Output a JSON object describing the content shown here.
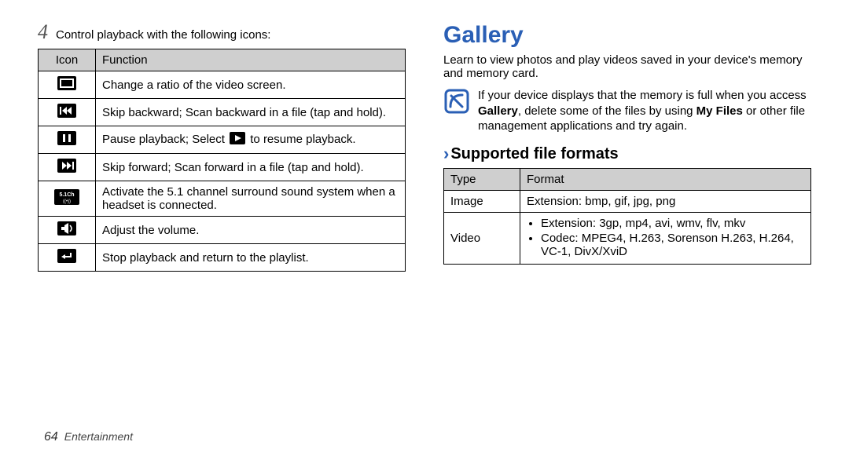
{
  "left": {
    "step_number": "4",
    "step_text": "Control playback with the following icons:",
    "table": {
      "headers": {
        "icon": "Icon",
        "function": "Function"
      },
      "rows": [
        {
          "icon": "ratio-icon",
          "text": "Change a ratio of the video screen."
        },
        {
          "icon": "skip-back-icon",
          "text": "Skip backward; Scan backward in a file (tap and hold)."
        },
        {
          "icon": "pause-icon",
          "text_before": "Pause playback; Select ",
          "text_after": " to resume playback.",
          "inline_icon": "play-icon"
        },
        {
          "icon": "skip-forward-icon",
          "text": "Skip forward; Scan forward in a file (tap and hold)."
        },
        {
          "icon": "surround-icon",
          "text": "Activate the 5.1 channel surround sound system when a headset is connected."
        },
        {
          "icon": "volume-icon",
          "text": "Adjust the volume."
        },
        {
          "icon": "return-icon",
          "text": "Stop playback and return to the playlist."
        }
      ]
    }
  },
  "right": {
    "title": "Gallery",
    "intro": "Learn to view photos and play videos saved in your device's memory and memory card.",
    "note": {
      "pre": "If your device displays that the memory is full when you access ",
      "bold1": "Gallery",
      "mid": ", delete some of the files by using ",
      "bold2": "My Files",
      "post": " or other file management applications and try again."
    },
    "section_title": "Supported file formats",
    "formats": {
      "headers": {
        "type": "Type",
        "format": "Format"
      },
      "rows": [
        {
          "type": "Image",
          "kind": "single",
          "text": "Extension: bmp, gif, jpg, png"
        },
        {
          "type": "Video",
          "kind": "list",
          "items": [
            "Extension: 3gp, mp4, avi, wmv, flv, mkv",
            "Codec: MPEG4, H.263, Sorenson H.263, H.264, VC-1, DivX/XviD"
          ]
        }
      ]
    }
  },
  "footer": {
    "page": "64",
    "section": "Entertainment"
  },
  "icons": {
    "ratio-icon": "ratio",
    "skip-back-icon": "prev",
    "pause-icon": "pause",
    "play-icon": "play",
    "skip-forward-icon": "next",
    "surround-icon": "5.1Ch",
    "volume-icon": "vol",
    "return-icon": "return",
    "note-icon": "note"
  }
}
